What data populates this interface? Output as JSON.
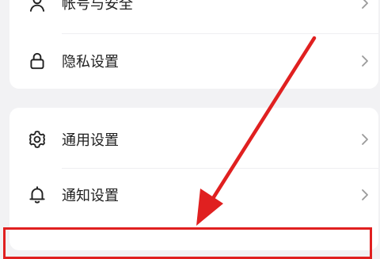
{
  "account_section": {
    "items": [
      {
        "label": "帐号与安全",
        "icon": "user-icon"
      },
      {
        "label": "隐私设置",
        "icon": "lock-icon"
      }
    ]
  },
  "general_section": {
    "items": [
      {
        "label": "通用设置",
        "icon": "gear-icon"
      },
      {
        "label": "通知设置",
        "icon": "bell-icon"
      }
    ]
  },
  "annotation": {
    "arrow_color": "#e02020",
    "highlight_color": "#e02020"
  }
}
